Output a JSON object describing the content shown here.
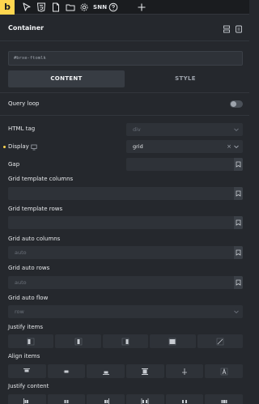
{
  "toolbar": {
    "logo": "b",
    "icons": [
      "cursor-icon",
      "html5-icon",
      "page-icon",
      "folder-icon",
      "gear-icon"
    ],
    "plugin_label": "SNN",
    "help_icon": "help-icon",
    "add_icon": "plus-icon"
  },
  "header": {
    "title": "Container"
  },
  "css_id": "#brxe-ftomlk",
  "tabs": {
    "content": "CONTENT",
    "style": "STYLE"
  },
  "controls": {
    "query_loop": {
      "label": "Query loop",
      "enabled": false
    },
    "html_tag": {
      "label": "HTML tag",
      "placeholder": "div"
    },
    "display": {
      "label": "Display",
      "value": "grid",
      "clear": "×"
    },
    "gap": {
      "label": "Gap"
    },
    "grid_template_columns": {
      "label": "Grid template columns"
    },
    "grid_template_rows": {
      "label": "Grid template rows"
    },
    "grid_auto_columns": {
      "label": "Grid auto columns",
      "placeholder": "auto"
    },
    "grid_auto_rows": {
      "label": "Grid auto rows",
      "placeholder": "auto"
    },
    "grid_auto_flow": {
      "label": "Grid auto flow",
      "placeholder": "row"
    },
    "justify_items": {
      "label": "Justify items"
    },
    "align_items": {
      "label": "Align items"
    },
    "justify_content": {
      "label": "Justify content"
    }
  },
  "colors": {
    "accent": "#ffd64f",
    "background": "#25282d",
    "field": "#2e3238"
  }
}
